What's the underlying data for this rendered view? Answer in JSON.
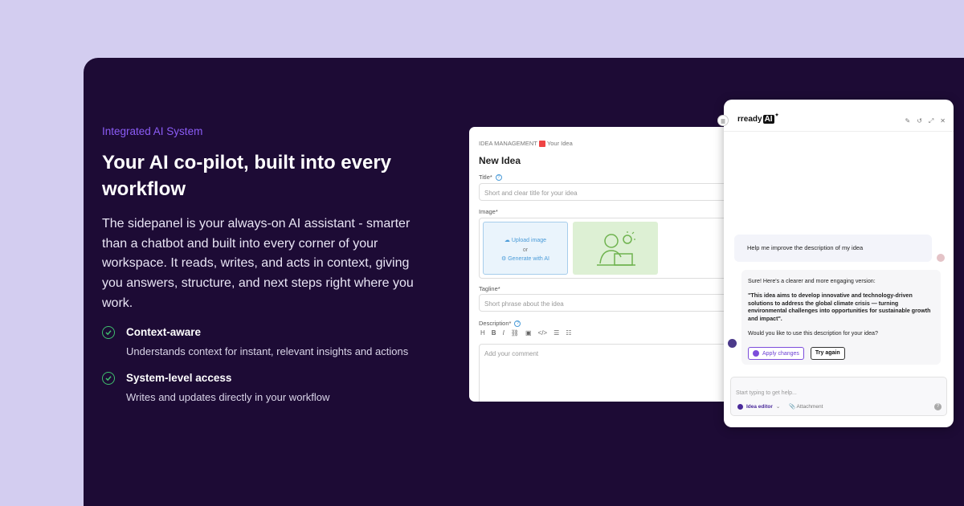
{
  "hero": {
    "eyebrow": "Integrated AI System",
    "headline": "Your AI co-pilot, built into every workflow",
    "body": "The sidepanel is your always-on AI assistant - smarter than a chatbot and built into every corner of your workspace. It reads, writes, and acts in context, giving you answers, structure, and next steps right where you work.",
    "features": [
      {
        "title": "Context-aware",
        "desc": "Understands context for instant, relevant insights and actions"
      },
      {
        "title": "System-level access",
        "desc": "Writes and updates directly in your workflow"
      }
    ]
  },
  "form": {
    "breadcrumb_section": "IDEA MANAGEMENT",
    "breadcrumb_page": "Your Idea",
    "title": "New Idea",
    "title_label": "Title*",
    "title_placeholder": "Short and clear title for your idea",
    "image_label": "Image*",
    "upload_label": "Upload image",
    "or_label": "or",
    "generate_label": "Generate with AI",
    "tagline_label": "Tagline*",
    "tagline_placeholder": "Short phrase about the idea",
    "description_label": "Description*",
    "toolbar": [
      "H",
      "B",
      "I",
      "⛓",
      "▣",
      "</>",
      "☰",
      "☷"
    ],
    "description_placeholder": "Add your comment"
  },
  "chat": {
    "logo": "rready",
    "logo_ai": "AI",
    "user_message": "Help me improve the description of my idea",
    "bot_intro": "Sure! Here's a clearer and more engaging version:",
    "bot_quote": "\"This idea aims to develop innovative and technology-driven solutions to address the global climate crisis — turning environmental challenges into opportunities for sustainable growth and impact\".",
    "bot_question": "Would you like to use this description for your idea?",
    "apply_label": "Apply changes",
    "try_label": "Try again",
    "composer_placeholder": "Start typing to get help...",
    "mode_label": "Idea editor",
    "attach_label": "Attachment"
  },
  "colors": {
    "background": "#d3cdf0",
    "panel": "#1d0b35",
    "accent": "#8b5cf6",
    "check": "#3fbf6e"
  }
}
